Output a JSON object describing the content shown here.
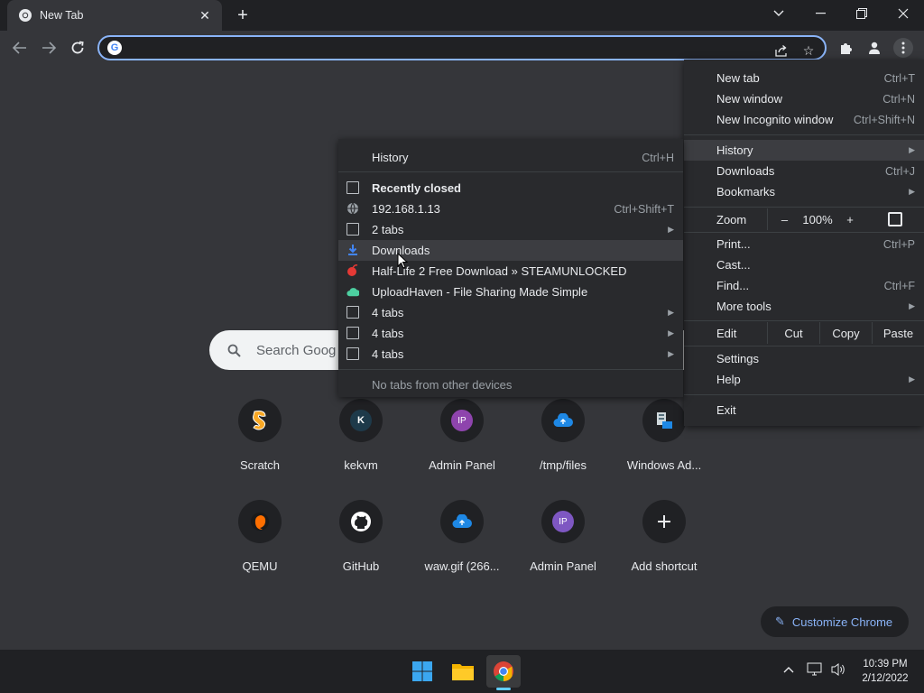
{
  "window": {
    "tab_title": "New Tab",
    "colors": {
      "accent": "#8ab4f8",
      "frame": "#202124",
      "surface": "#35363a",
      "menu": "#292a2d"
    }
  },
  "toolbar": {
    "omnibox_value": ""
  },
  "ntp": {
    "search_placeholder": "Search Goog",
    "shortcuts_row1": [
      {
        "label": "Scratch",
        "icon": "scratch-icon"
      },
      {
        "label": "kekvm",
        "icon": "k-icon",
        "badge": "K"
      },
      {
        "label": "Admin Panel",
        "icon": "ip-icon",
        "badge": "IP"
      },
      {
        "label": "/tmp/files",
        "icon": "cloud-upload-icon"
      },
      {
        "label": "Windows Ad...",
        "icon": "windows-admin-icon"
      }
    ],
    "shortcuts_row2": [
      {
        "label": "QEMU",
        "icon": "qemu-icon"
      },
      {
        "label": "GitHub",
        "icon": "github-icon"
      },
      {
        "label": "waw.gif (266...",
        "icon": "cloud-upload-icon"
      },
      {
        "label": "Admin Panel",
        "icon": "ip-icon",
        "badge": "IP"
      },
      {
        "label": "Add shortcut",
        "icon": "plus-icon"
      }
    ],
    "customize_label": "Customize Chrome"
  },
  "chrome_menu": {
    "items": [
      {
        "label": "New tab",
        "shortcut": "Ctrl+T"
      },
      {
        "label": "New window",
        "shortcut": "Ctrl+N"
      },
      {
        "label": "New Incognito window",
        "shortcut": "Ctrl+Shift+N"
      },
      {
        "label": "History",
        "submenu": true,
        "highlighted": true
      },
      {
        "label": "Downloads",
        "shortcut": "Ctrl+J"
      },
      {
        "label": "Bookmarks",
        "submenu": true
      },
      {
        "label": "Print...",
        "shortcut": "Ctrl+P"
      },
      {
        "label": "Cast..."
      },
      {
        "label": "Find...",
        "shortcut": "Ctrl+F"
      },
      {
        "label": "More tools",
        "submenu": true
      },
      {
        "label": "Settings"
      },
      {
        "label": "Help",
        "submenu": true
      },
      {
        "label": "Exit"
      }
    ],
    "zoom": {
      "label": "Zoom",
      "minus": "–",
      "value": "100%",
      "plus": "+"
    },
    "edit": {
      "label": "Edit",
      "cut": "Cut",
      "copy": "Copy",
      "paste": "Paste"
    }
  },
  "history_menu": {
    "items": [
      {
        "label": "History",
        "shortcut": "Ctrl+H"
      },
      {
        "label": "Recently closed",
        "bold": true
      },
      {
        "label": "192.168.1.13",
        "shortcut": "Ctrl+Shift+T",
        "icon": "globe-icon"
      },
      {
        "label": "2 tabs",
        "submenu": true,
        "icon": "tabs-icon"
      },
      {
        "label": "Downloads",
        "icon": "download-icon",
        "highlighted": true
      },
      {
        "label": "Half-Life 2 Free Download » STEAMUNLOCKED",
        "icon": "steamunlocked-icon"
      },
      {
        "label": "UploadHaven - File Sharing Made Simple",
        "icon": "uploadhaven-icon"
      },
      {
        "label": "4 tabs",
        "submenu": true,
        "icon": "tabs-icon"
      },
      {
        "label": "4 tabs",
        "submenu": true,
        "icon": "tabs-icon"
      },
      {
        "label": "4 tabs",
        "submenu": true,
        "icon": "tabs-icon"
      },
      {
        "label": "No tabs from other devices",
        "muted": true
      }
    ]
  },
  "taskbar": {
    "time": "10:39 PM",
    "date": "2/12/2022"
  }
}
